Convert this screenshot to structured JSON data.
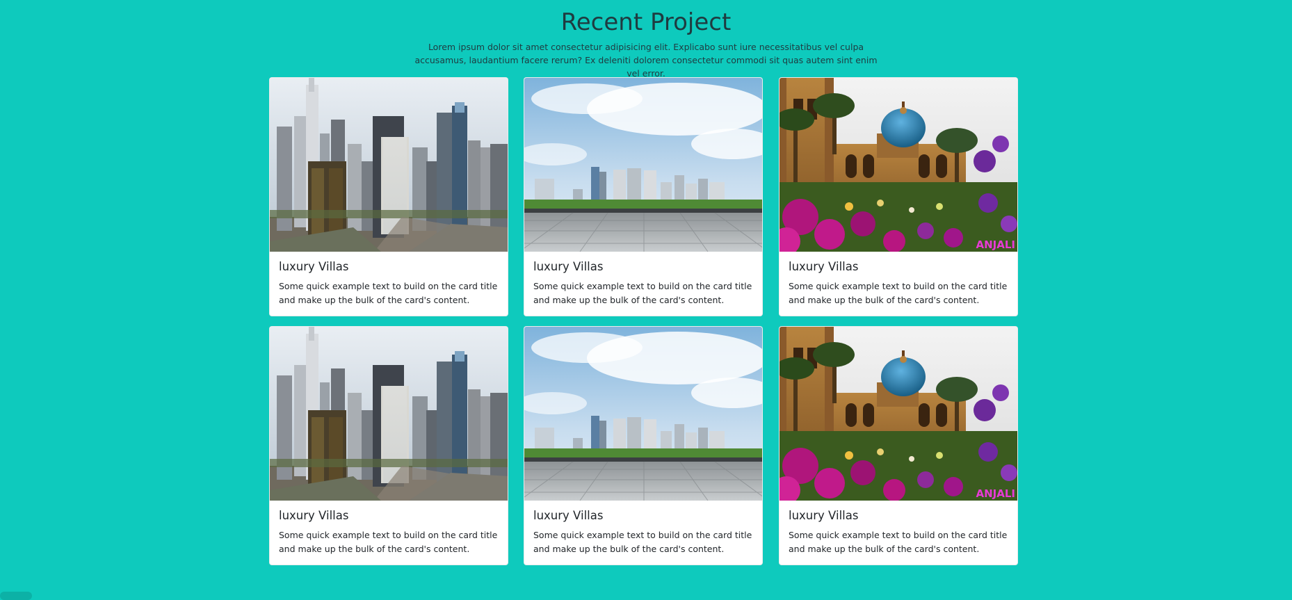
{
  "section": {
    "title": "Recent Project",
    "lead": "Lorem ipsum dolor sit amet consectetur adipisicing elit. Explicabo sunt iure necessitatibus vel culpa accusamus, laudantium facere rerum? Ex deleniti dolorem consectetur commodi sit quas autem sint enim vel error."
  },
  "cards": [
    {
      "image": "downtown-skyscrapers-photo",
      "title": "luxury Villas",
      "text": "Some quick example text to build on the card title and make up the bulk of the card's content."
    },
    {
      "image": "city-skyline-plaza-photo",
      "title": "luxury Villas",
      "text": "Some quick example text to build on the card title and make up the bulk of the card's content."
    },
    {
      "image": "palace-with-flowers-photo",
      "title": "luxury Villas",
      "text": "Some quick example text to build on the card title and make up the bulk of the card's content.",
      "watermark": "ANJALI"
    },
    {
      "image": "downtown-skyscrapers-photo",
      "title": "luxury Villas",
      "text": "Some quick example text to build on the card title and make up the bulk of the card's content."
    },
    {
      "image": "city-skyline-plaza-photo",
      "title": "luxury Villas",
      "text": "Some quick example text to build on the card title and make up the bulk of the card's content."
    },
    {
      "image": "palace-with-flowers-photo",
      "title": "luxury Villas",
      "text": "Some quick example text to build on the card title and make up the bulk of the card's content.",
      "watermark": "ANJALI"
    }
  ],
  "colors": {
    "page_background": "#0ecabd",
    "card_background": "#ffffff",
    "heading": "#1f3b40",
    "watermark": "#e83ad6"
  }
}
